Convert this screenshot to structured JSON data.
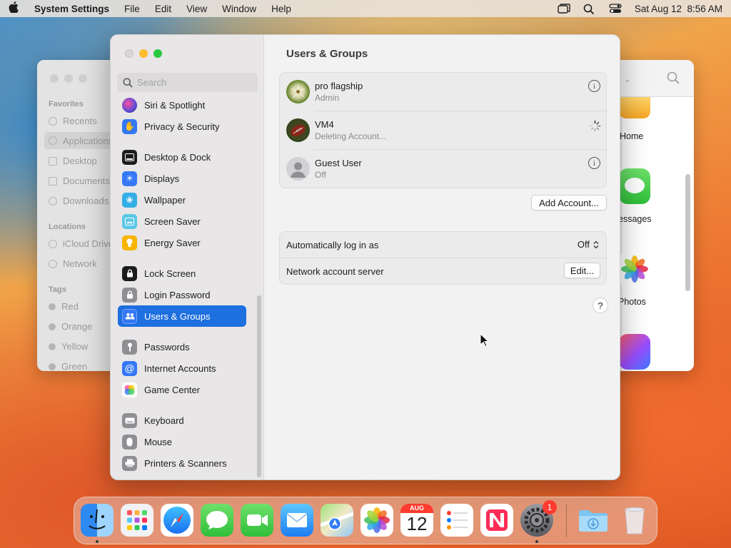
{
  "menubar": {
    "app_name": "System Settings",
    "menus": [
      "File",
      "Edit",
      "View",
      "Window",
      "Help"
    ],
    "clock": "Sat Aug 12  8:56 AM"
  },
  "finder": {
    "sections": {
      "favorites": "Favorites",
      "locations": "Locations",
      "tags": "Tags"
    },
    "favorites": [
      "Recents",
      "Applications",
      "Desktop",
      "Documents",
      "Downloads"
    ],
    "locations": [
      "iCloud Drive",
      "Network"
    ],
    "tags": [
      "Red",
      "Orange",
      "Yellow",
      "Green"
    ],
    "apps": [
      "Home",
      "essages",
      "Photos"
    ]
  },
  "sidebar": {
    "search_placeholder": "Search",
    "items": [
      {
        "label": "Siri & Spotlight",
        "color": "#5b4bd6"
      },
      {
        "label": "Privacy & Security",
        "color": "#3478f6"
      },
      {
        "label": "Desktop & Dock",
        "color": "#1c1c1e"
      },
      {
        "label": "Displays",
        "color": "#3478f6"
      },
      {
        "label": "Wallpaper",
        "color": "#33aee6"
      },
      {
        "label": "Screen Saver",
        "color": "#5ac8e6"
      },
      {
        "label": "Energy Saver",
        "color": "#f8b400"
      },
      {
        "label": "Lock Screen",
        "color": "#1c1c1e"
      },
      {
        "label": "Login Password",
        "color": "#8e8e93"
      },
      {
        "label": "Users & Groups",
        "color": "#3478f6"
      },
      {
        "label": "Passwords",
        "color": "#8e8e93"
      },
      {
        "label": "Internet Accounts",
        "color": "#3478f6"
      },
      {
        "label": "Game Center",
        "color": "#ffffff"
      },
      {
        "label": "Keyboard",
        "color": "#8e8e93"
      },
      {
        "label": "Mouse",
        "color": "#8e8e93"
      },
      {
        "label": "Printers & Scanners",
        "color": "#8e8e93"
      }
    ]
  },
  "main": {
    "title": "Users & Groups",
    "users": [
      {
        "name": "pro flagship",
        "role": "Admin"
      },
      {
        "name": "VM4",
        "role": "Deleting Account..."
      },
      {
        "name": "Guest User",
        "role": "Off"
      }
    ],
    "add_account": "Add Account...",
    "auto_login_label": "Automatically log in as",
    "auto_login_value": "Off",
    "network_server_label": "Network account server",
    "edit_button": "Edit...",
    "help": "?"
  },
  "dock": {
    "calendar_month": "AUG",
    "calendar_day": "12",
    "settings_badge": "1"
  },
  "colors": {
    "accent": "#1e6fe0",
    "badge": "#ff3b30"
  }
}
